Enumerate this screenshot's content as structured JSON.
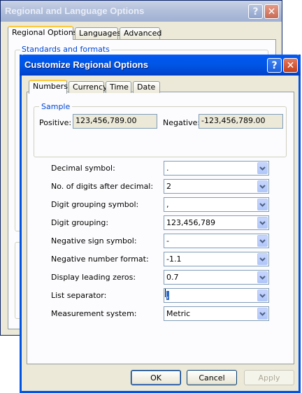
{
  "background_window": {
    "title": "Regional and Language Options",
    "tabs": [
      {
        "label": "Regional Options",
        "active": true
      },
      {
        "label": "Languages",
        "active": false
      },
      {
        "label": "Advanced",
        "active": false
      }
    ],
    "group_label": "Standards and formats"
  },
  "dialog": {
    "title": "Customize Regional Options",
    "tabs": [
      {
        "label": "Numbers",
        "active": true
      },
      {
        "label": "Currency",
        "active": false
      },
      {
        "label": "Time",
        "active": false
      },
      {
        "label": "Date",
        "active": false
      }
    ],
    "sample": {
      "group_label": "Sample",
      "positive_label": "Positive:",
      "positive_value": "123,456,789.00",
      "negative_label": "Negative:",
      "negative_value": "-123,456,789.00"
    },
    "settings": [
      {
        "label": "Decimal symbol:",
        "value": "."
      },
      {
        "label": "No. of digits after decimal:",
        "value": "2"
      },
      {
        "label": "Digit grouping symbol:",
        "value": ","
      },
      {
        "label": "Digit grouping:",
        "value": "123,456,789"
      },
      {
        "label": "Negative sign symbol:",
        "value": "-"
      },
      {
        "label": "Negative number format:",
        "value": "-1.1"
      },
      {
        "label": "Display leading zeros:",
        "value": "0.7"
      },
      {
        "label": "List separator:",
        "value": ","
      },
      {
        "label": "Measurement system:",
        "value": "Metric"
      }
    ],
    "buttons": {
      "ok": "OK",
      "cancel": "Cancel",
      "apply": "Apply"
    },
    "caption_buttons": {
      "help": "?",
      "close": "✕"
    }
  }
}
